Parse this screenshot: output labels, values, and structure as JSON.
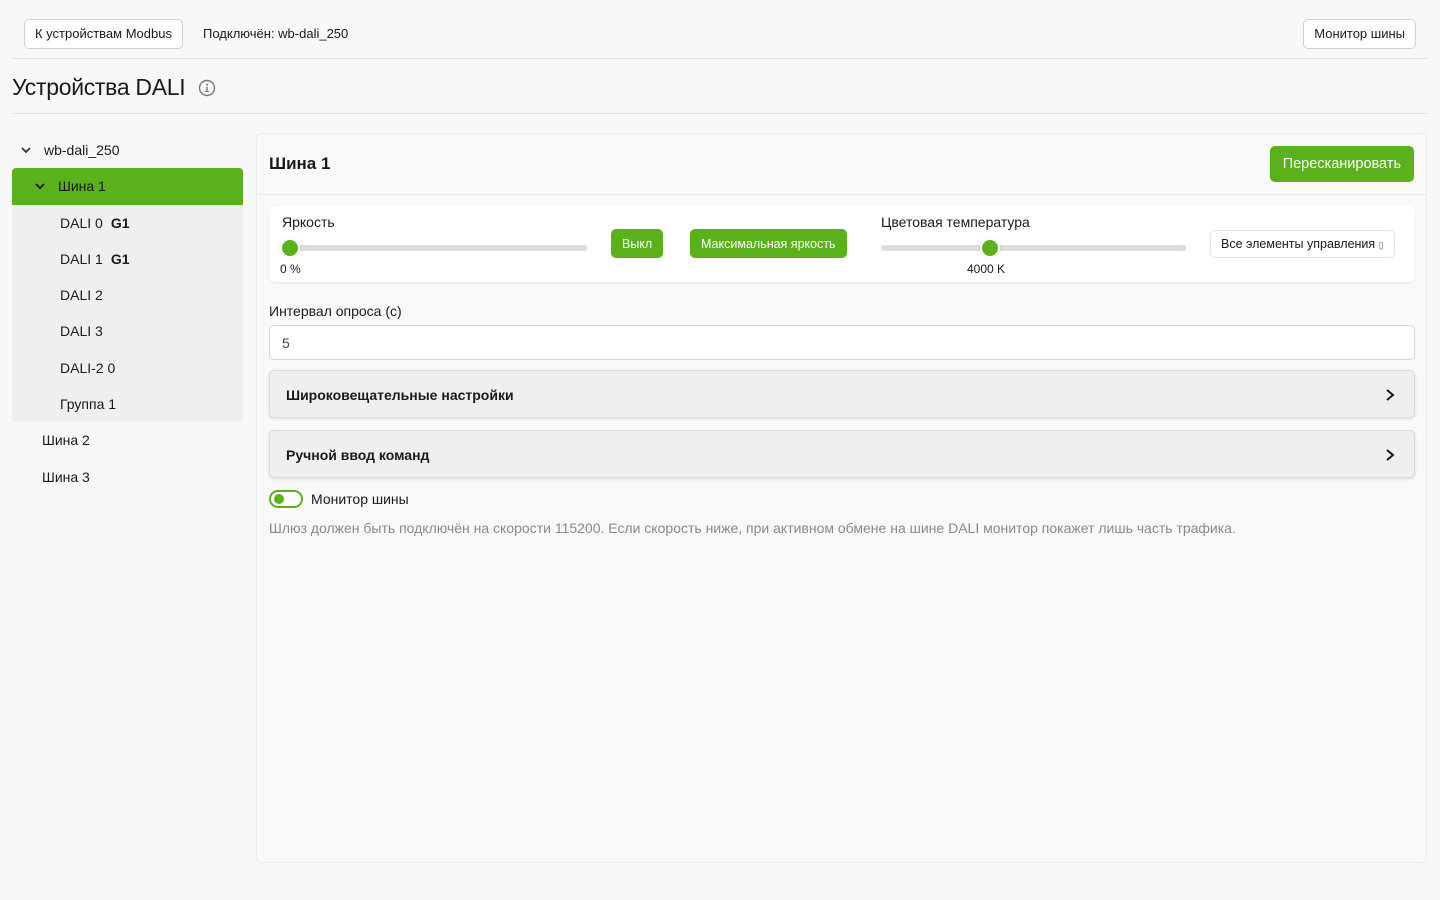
{
  "topbar": {
    "modbus_button": "К устройствам Modbus",
    "connection_text": "Подключён: wb-dali_250",
    "bus_monitor_button": "Монитор шины"
  },
  "page": {
    "title": "Устройства DALI"
  },
  "sidebar": {
    "root": "wb-dali_250",
    "active_bus": "Шина 1",
    "devices": [
      {
        "label": "DALI 0",
        "badge": "G1"
      },
      {
        "label": "DALI 1",
        "badge": "G1"
      },
      {
        "label": "DALI 2",
        "badge": ""
      },
      {
        "label": "DALI 3",
        "badge": ""
      },
      {
        "label": "DALI-2 0",
        "badge": ""
      },
      {
        "label": "Группа 1",
        "badge": ""
      }
    ],
    "other_buses": [
      "Шина 2",
      "Шина 3"
    ]
  },
  "main": {
    "title": "Шина 1",
    "rescan_button": "Пересканировать",
    "controls": {
      "brightness_label": "Яркость",
      "brightness_value": "0 %",
      "brightness_level": 0,
      "off_button": "Выкл",
      "max_brightness_button": "Максимальная яркость",
      "color_temp_label": "Цветовая температура",
      "color_temp_value": "4000 K",
      "color_temp_level": 0.35,
      "all_controls_button": "Все элементы управления"
    },
    "poll_interval_label": "Интервал опроса (с)",
    "poll_interval_value": "5",
    "accordions": [
      "Широковещательные настройки",
      "Ручной ввод команд"
    ],
    "bus_monitor_toggle_label": "Монитор шины",
    "bus_monitor_enabled": false,
    "hint": "Шлюз должен быть подключён на скорости 115200. Если скорость ниже, при активном обмене на шине DALI монитор покажет лишь часть трафика."
  },
  "colors": {
    "accent": "#5bb11b",
    "background": "#f7f8f7",
    "hint_text": "#8a8a8a"
  }
}
